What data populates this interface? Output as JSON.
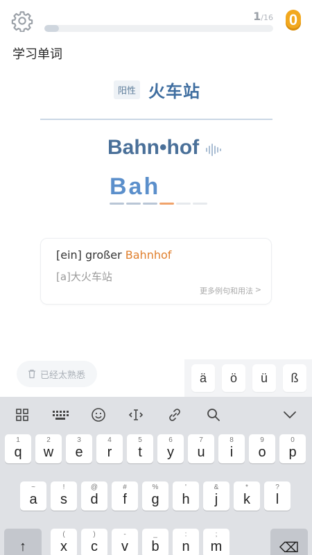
{
  "header": {
    "progress_current": "1",
    "progress_total": "/16",
    "progress_fraction": 0.0625,
    "coin_value": "0",
    "icon_settings": "gear-icon"
  },
  "section_title": "学习单词",
  "word": {
    "gender_tag": "阳性",
    "translation": "火车站",
    "german": "Bahn•hof",
    "audio_icon": "sound-wave-icon",
    "typed_answer": "Bah",
    "slots_total": 6,
    "slots_typed": 3
  },
  "example": {
    "prefix": "[ein] großer ",
    "highlight": "Bahnhof",
    "translation": "[a]大火车站",
    "more_label": "更多例句和用法",
    "more_chevron": ">"
  },
  "familiar_button": "已经太熟悉",
  "umlauts": [
    "ä",
    "ö",
    "ü",
    "ß"
  ],
  "keyboard": {
    "row1": [
      {
        "hint": "1",
        "key": "q"
      },
      {
        "hint": "2",
        "key": "w"
      },
      {
        "hint": "3",
        "key": "e"
      },
      {
        "hint": "4",
        "key": "r"
      },
      {
        "hint": "5",
        "key": "t"
      },
      {
        "hint": "6",
        "key": "y"
      },
      {
        "hint": "7",
        "key": "u"
      },
      {
        "hint": "8",
        "key": "i"
      },
      {
        "hint": "9",
        "key": "o"
      },
      {
        "hint": "0",
        "key": "p"
      }
    ],
    "row2": [
      {
        "hint": "~",
        "key": "a"
      },
      {
        "hint": "!",
        "key": "s"
      },
      {
        "hint": "@",
        "key": "d"
      },
      {
        "hint": "#",
        "key": "f"
      },
      {
        "hint": "%",
        "key": "g"
      },
      {
        "hint": "'",
        "key": "h"
      },
      {
        "hint": "&",
        "key": "j"
      },
      {
        "hint": "*",
        "key": "k"
      },
      {
        "hint": "?",
        "key": "l"
      }
    ],
    "row3": [
      {
        "hint": "(",
        "key": "x"
      },
      {
        "hint": ")",
        "key": "c"
      },
      {
        "hint": "-",
        "key": "v"
      },
      {
        "hint": "_",
        "key": "b"
      },
      {
        "hint": ":",
        "key": "n"
      },
      {
        "hint": ";",
        "key": "m"
      }
    ],
    "toolbar_icons": [
      "grid-icon",
      "keyboard-icon",
      "emoji-icon",
      "cursor-icon",
      "link-icon",
      "search-icon",
      "collapse-icon"
    ],
    "shift_label": "↑",
    "backspace_label": "⌫"
  },
  "colors": {
    "accent": "#3f6ea0",
    "highlight": "#e07f2c",
    "coin": "#f2a81e"
  }
}
